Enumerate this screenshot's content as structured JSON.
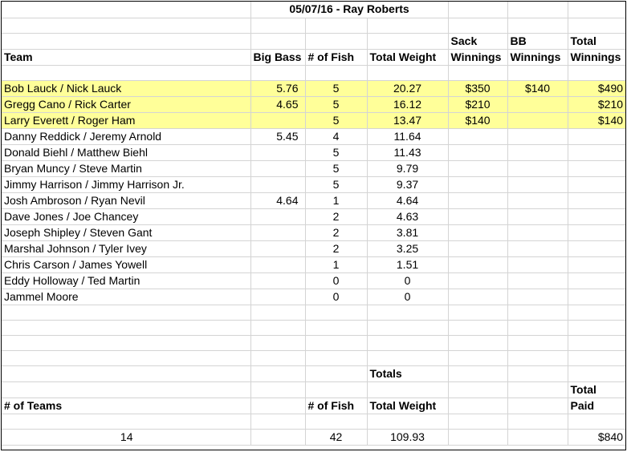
{
  "title": "05/07/16 - Ray Roberts",
  "headers": {
    "team": "Team",
    "big_bass": "Big Bass",
    "num_fish": "# of Fish",
    "total_weight": "Total Weight",
    "sack_winnings_1": "Sack",
    "sack_winnings_2": "Winnings",
    "bb_winnings_1": "BB",
    "bb_winnings_2": "Winnings",
    "total_winnings_1": "Total",
    "total_winnings_2": "Winnings"
  },
  "rows": [
    {
      "team": "Bob Lauck / Nick Lauck",
      "big_bass": "5.76",
      "fish": "5",
      "weight": "20.27",
      "sack": "$350",
      "bb": "$140",
      "total": "$490",
      "highlight": true
    },
    {
      "team": "Gregg Cano / Rick Carter",
      "big_bass": "4.65",
      "fish": "5",
      "weight": "16.12",
      "sack": "$210",
      "bb": "",
      "total": "$210",
      "highlight": true
    },
    {
      "team": "Larry Everett / Roger Ham",
      "big_bass": "",
      "fish": "5",
      "weight": "13.47",
      "sack": "$140",
      "bb": "",
      "total": "$140",
      "highlight": true
    },
    {
      "team": "Danny Reddick / Jeremy Arnold",
      "big_bass": "5.45",
      "fish": "4",
      "weight": "11.64",
      "sack": "",
      "bb": "",
      "total": "",
      "highlight": false
    },
    {
      "team": "Donald Biehl / Matthew Biehl",
      "big_bass": "",
      "fish": "5",
      "weight": "11.43",
      "sack": "",
      "bb": "",
      "total": "",
      "highlight": false
    },
    {
      "team": "Bryan Muncy / Steve Martin",
      "big_bass": "",
      "fish": "5",
      "weight": "9.79",
      "sack": "",
      "bb": "",
      "total": "",
      "highlight": false
    },
    {
      "team": "Jimmy Harrison / Jimmy Harrison Jr.",
      "big_bass": "",
      "fish": "5",
      "weight": "9.37",
      "sack": "",
      "bb": "",
      "total": "",
      "highlight": false
    },
    {
      "team": "Josh Ambroson / Ryan Nevil",
      "big_bass": "4.64",
      "fish": "1",
      "weight": "4.64",
      "sack": "",
      "bb": "",
      "total": "",
      "highlight": false
    },
    {
      "team": "Dave Jones / Joe Chancey",
      "big_bass": "",
      "fish": "2",
      "weight": "4.63",
      "sack": "",
      "bb": "",
      "total": "",
      "highlight": false
    },
    {
      "team": "Joseph Shipley / Steven Gant",
      "big_bass": "",
      "fish": "2",
      "weight": "3.81",
      "sack": "",
      "bb": "",
      "total": "",
      "highlight": false
    },
    {
      "team": "Marshal Johnson / Tyler Ivey",
      "big_bass": "",
      "fish": "2",
      "weight": "3.25",
      "sack": "",
      "bb": "",
      "total": "",
      "highlight": false
    },
    {
      "team": "Chris Carson / James Yowell",
      "big_bass": "",
      "fish": "1",
      "weight": "1.51",
      "sack": "",
      "bb": "",
      "total": "",
      "highlight": false
    },
    {
      "team": "Eddy Holloway / Ted Martin",
      "big_bass": "",
      "fish": "0",
      "weight": "0",
      "sack": "",
      "bb": "",
      "total": "",
      "highlight": false
    },
    {
      "team": "Jammel Moore",
      "big_bass": "",
      "fish": "0",
      "weight": "0",
      "sack": "",
      "bb": "",
      "total": "",
      "highlight": false
    }
  ],
  "totals": {
    "label": "Totals",
    "num_teams_label": "# of Teams",
    "num_fish_label": "# of Fish",
    "total_weight_label": "Total Weight",
    "total_paid_1": "Total",
    "total_paid_2": "Paid",
    "num_teams": "14",
    "num_fish": "42",
    "total_weight": "109.93",
    "total_paid": "$840"
  },
  "colors": {
    "highlight": "#ffff99",
    "gridline": "#d4d4d4"
  }
}
